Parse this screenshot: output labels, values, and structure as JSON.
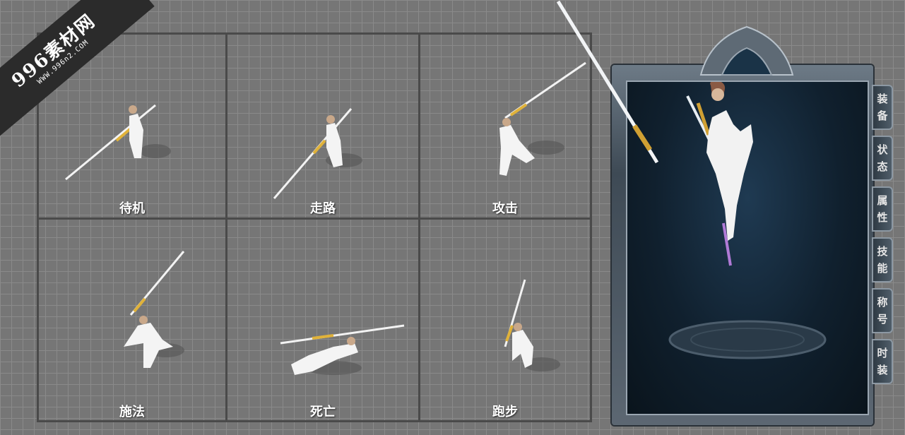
{
  "watermark": {
    "title": "996素材网",
    "url": "WWW.996n2.COM"
  },
  "animations": [
    {
      "label": "待机"
    },
    {
      "label": "走路"
    },
    {
      "label": "攻击"
    },
    {
      "label": "施法"
    },
    {
      "label": "死亡"
    },
    {
      "label": "跑步"
    }
  ],
  "character_panel": {
    "tabs": [
      {
        "chars": [
          "装",
          "备"
        ]
      },
      {
        "chars": [
          "状",
          "态"
        ]
      },
      {
        "chars": [
          "属",
          "性"
        ]
      },
      {
        "chars": [
          "技",
          "能"
        ]
      },
      {
        "chars": [
          "称",
          "号"
        ]
      },
      {
        "chars": [
          "时",
          "装"
        ]
      }
    ]
  }
}
